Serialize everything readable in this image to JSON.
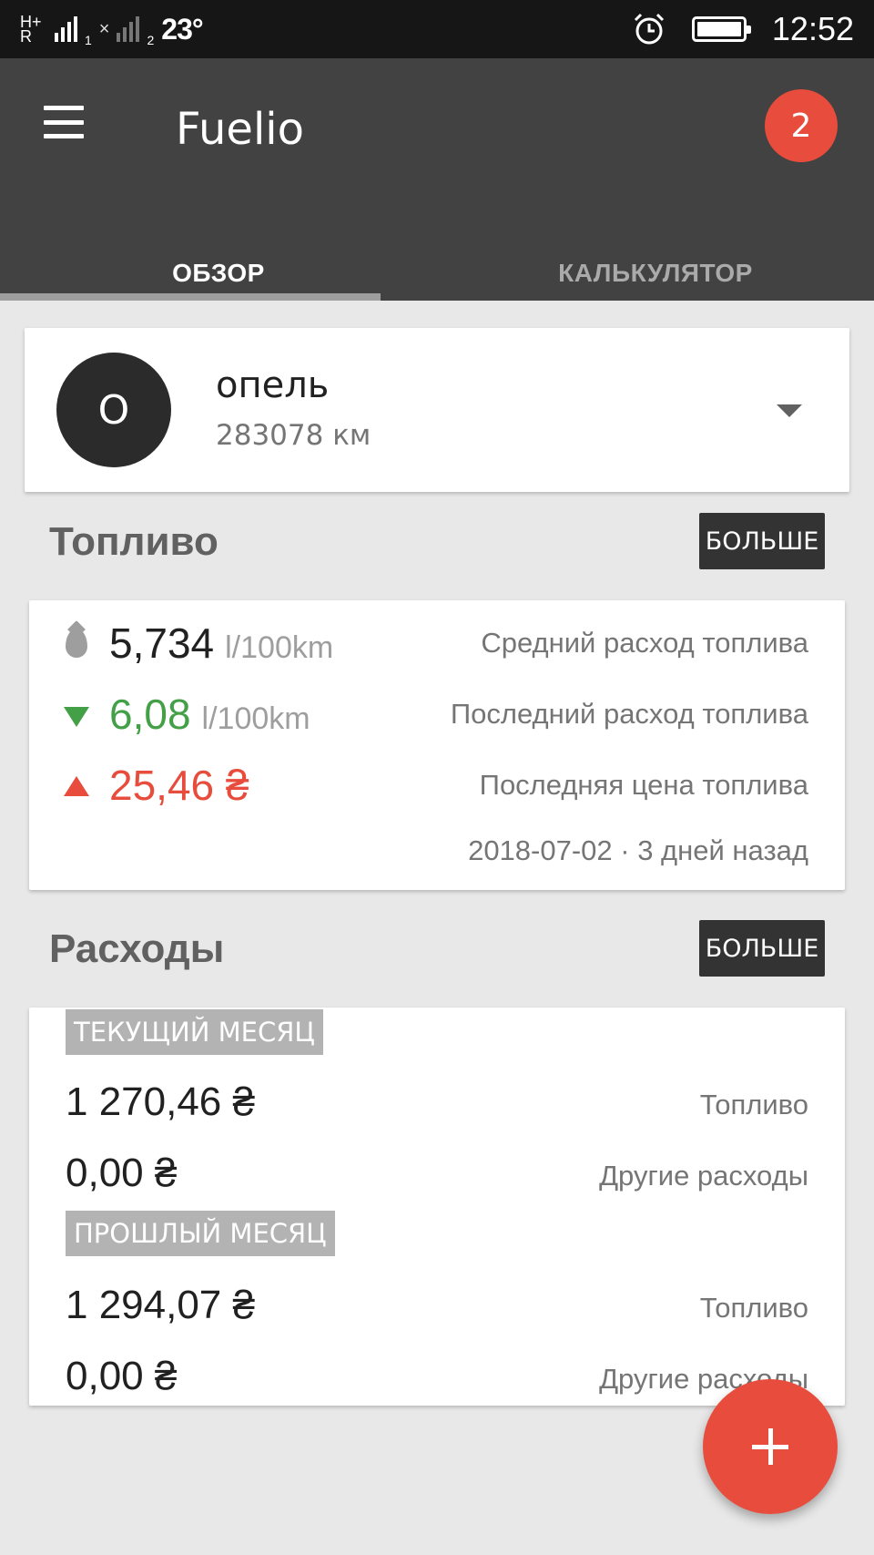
{
  "status_bar": {
    "network_label": "H+ R",
    "sim2_label": "1",
    "sim2_index": "2",
    "temperature": "23°",
    "time": "12:52"
  },
  "app_bar": {
    "title": "Fuelio",
    "notification_count": "2",
    "tabs": [
      "ОБЗОР",
      "КАЛЬКУЛЯТОР"
    ]
  },
  "vehicle": {
    "avatar_letter": "О",
    "name": "опель",
    "odometer": "283078 км"
  },
  "fuel_section": {
    "title": "Топливо",
    "more_label": "БОЛЬШЕ",
    "rows": [
      {
        "icon": "drop-icon",
        "value": "5,734",
        "unit": "l/100km",
        "label": "Средний расход топлива"
      },
      {
        "icon": "arrow-down-icon",
        "value": "6,08",
        "unit": "l/100km",
        "label": "Последний расход топлива"
      },
      {
        "icon": "arrow-up-icon",
        "value": "25,46 ₴",
        "unit": "",
        "label": "Последняя цена топлива"
      }
    ],
    "last_update": "2018-07-02 · 3 дней назад",
    "colors": {
      "good": "#43a047",
      "bad": "#e74c3c"
    }
  },
  "expenses_section": {
    "title": "Расходы",
    "more_label": "БОЛЬШЕ",
    "current_month": {
      "label": "ТЕКУЩИЙ МЕСЯЦ",
      "fuel_value": "1 270,46 ₴",
      "fuel_label": "Топливо",
      "other_value": "0,00 ₴",
      "other_label": "Другие расходы"
    },
    "previous_month": {
      "label": "ПРОШЛЫЙ МЕСЯЦ",
      "fuel_value": "1 294,07 ₴",
      "fuel_label": "Топливо",
      "other_value": "0,00 ₴",
      "other_label": "Другие расходы"
    }
  },
  "fab": {
    "icon": "plus-icon",
    "color": "#e74c3c"
  }
}
